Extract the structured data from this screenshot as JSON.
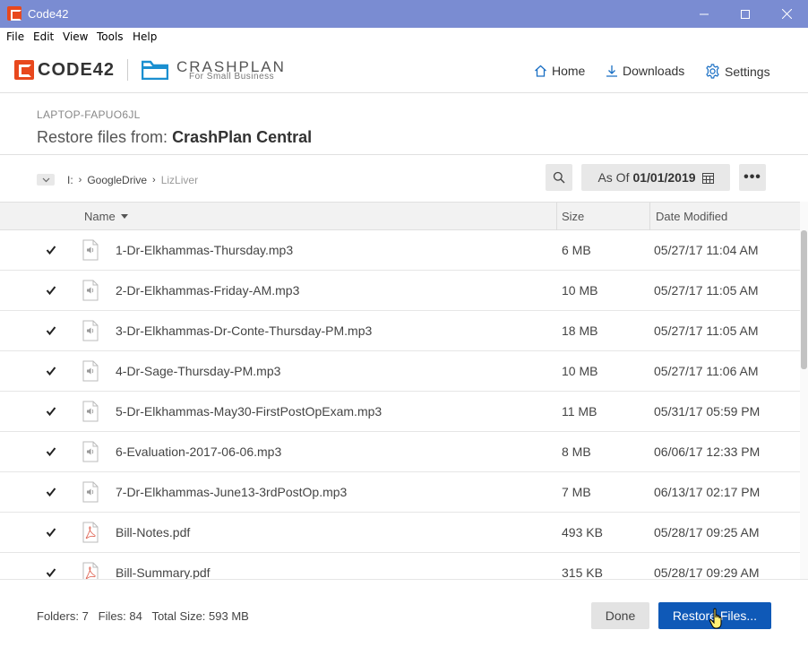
{
  "window": {
    "title": "Code42",
    "minimize_icon": "minimize-icon",
    "maximize_icon": "maximize-icon",
    "close_icon": "close-icon"
  },
  "menu": [
    "File",
    "Edit",
    "View",
    "Tools",
    "Help"
  ],
  "header": {
    "brand": "CODE42",
    "product": "CRASHPLAN",
    "product_sub": "For Small Business",
    "nav": [
      {
        "label": "Home",
        "icon": "home-icon"
      },
      {
        "label": "Downloads",
        "icon": "download-icon"
      },
      {
        "label": "Settings",
        "icon": "gear-icon"
      }
    ],
    "colors": {
      "brand_orange": "#e8481d",
      "crashplan_blue": "#1a8fd0"
    }
  },
  "restore": {
    "device": "LAPTOP-FAPUO6JL",
    "title_prefix": "Restore files from:",
    "source": "CrashPlan Central"
  },
  "breadcrumb": [
    "I:",
    "GoogleDrive",
    "LizLiver"
  ],
  "toolbar": {
    "search_icon": "search-icon",
    "as_of_label": "As Of",
    "as_of_date": "01/01/2019",
    "calendar_icon": "calendar-icon",
    "more_label": "•••"
  },
  "table": {
    "columns": {
      "name": "Name",
      "size": "Size",
      "date": "Date Modified"
    },
    "sort": {
      "column": "Name",
      "direction": "descending"
    },
    "rows": [
      {
        "checked": true,
        "type": "audio",
        "name": "1-Dr-Elkhammas-Thursday.mp3",
        "size": "6 MB",
        "date": "05/27/17 11:04 AM"
      },
      {
        "checked": true,
        "type": "audio",
        "name": "2-Dr-Elkhammas-Friday-AM.mp3",
        "size": "10 MB",
        "date": "05/27/17 11:05 AM"
      },
      {
        "checked": true,
        "type": "audio",
        "name": "3-Dr-Elkhammas-Dr-Conte-Thursday-PM.mp3",
        "size": "18 MB",
        "date": "05/27/17 11:05 AM"
      },
      {
        "checked": true,
        "type": "audio",
        "name": "4-Dr-Sage-Thursday-PM.mp3",
        "size": "10 MB",
        "date": "05/27/17 11:06 AM"
      },
      {
        "checked": true,
        "type": "audio",
        "name": "5-Dr-Elkhammas-May30-FirstPostOpExam.mp3",
        "size": "11 MB",
        "date": "05/31/17 05:59 PM"
      },
      {
        "checked": true,
        "type": "audio",
        "name": "6-Evaluation-2017-06-06.mp3",
        "size": "8 MB",
        "date": "06/06/17 12:33 PM"
      },
      {
        "checked": true,
        "type": "audio",
        "name": "7-Dr-Elkhammas-June13-3rdPostOp.mp3",
        "size": "7 MB",
        "date": "06/13/17 02:17 PM"
      },
      {
        "checked": true,
        "type": "pdf",
        "name": "Bill-Notes.pdf",
        "size": "493 KB",
        "date": "05/28/17 09:25 AM"
      },
      {
        "checked": true,
        "type": "pdf",
        "name": "Bill-Summary.pdf",
        "size": "315 KB",
        "date": "05/28/17 09:29 AM"
      }
    ]
  },
  "footer": {
    "folders_label": "Folders:",
    "folders": "7",
    "files_label": "Files:",
    "files": "84",
    "total_label": "Total Size:",
    "total": "593 MB",
    "done_label": "Done",
    "restore_label": "Restore Files..."
  }
}
